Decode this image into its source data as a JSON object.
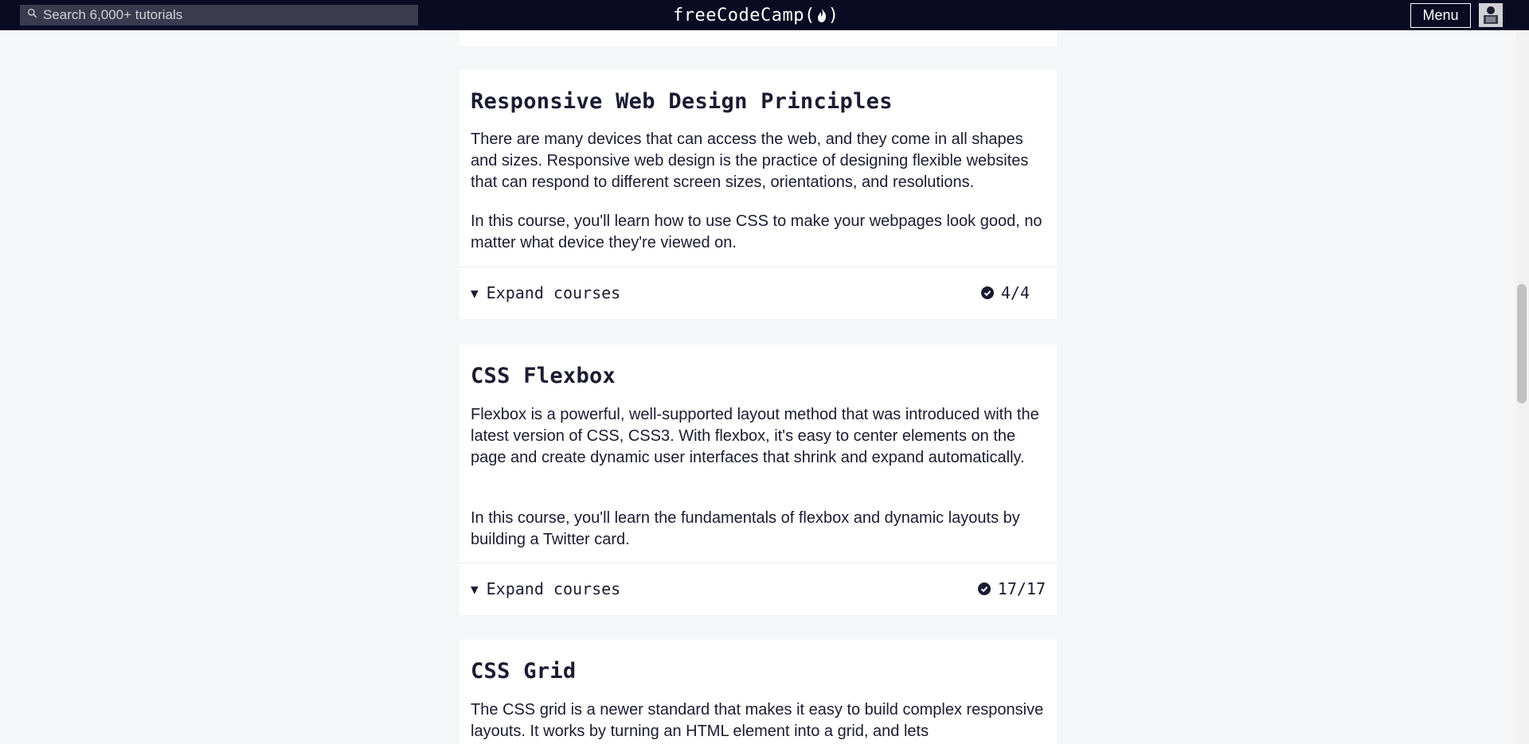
{
  "nav": {
    "search_placeholder": "Search 6,000+ tutorials",
    "logo_text": "freeCodeCamp",
    "logo_open": "(",
    "logo_close": ")",
    "menu_label": "Menu"
  },
  "cards": [
    {
      "title": "Responsive Web Design Principles",
      "paragraphs": [
        "There are many devices that can access the web, and they come in all shapes and sizes. Responsive web design is the practice of designing flexible websites that can respond to different screen sizes, orientations, and resolutions.",
        "In this course, you'll learn how to use CSS to make your webpages look good, no matter what device they're viewed on."
      ],
      "expand_label": "Expand courses",
      "progress": "4/4"
    },
    {
      "title": "CSS Flexbox",
      "paragraphs": [
        "Flexbox is a powerful, well-supported layout method that was introduced with the latest version of CSS, CSS3. With flexbox, it's easy to center elements on the page and create dynamic user interfaces that shrink and expand automatically.",
        "In this course, you'll learn the fundamentals of flexbox and dynamic layouts by building a Twitter card."
      ],
      "expand_label": "Expand courses",
      "progress": "17/17"
    },
    {
      "title": "CSS Grid",
      "paragraphs": [
        "The CSS grid is a newer standard that makes it easy to build complex responsive layouts. It works by turning an HTML element into a grid, and lets"
      ]
    }
  ],
  "colors": {
    "nav_bg": "#0a0a23",
    "page_bg": "#f5f6f7",
    "card_bg": "#ffffff",
    "text": "#1b1b32"
  },
  "icons": [
    "search-icon",
    "flame-icon",
    "check-circle-icon",
    "triangle-down-icon",
    "avatar"
  ]
}
